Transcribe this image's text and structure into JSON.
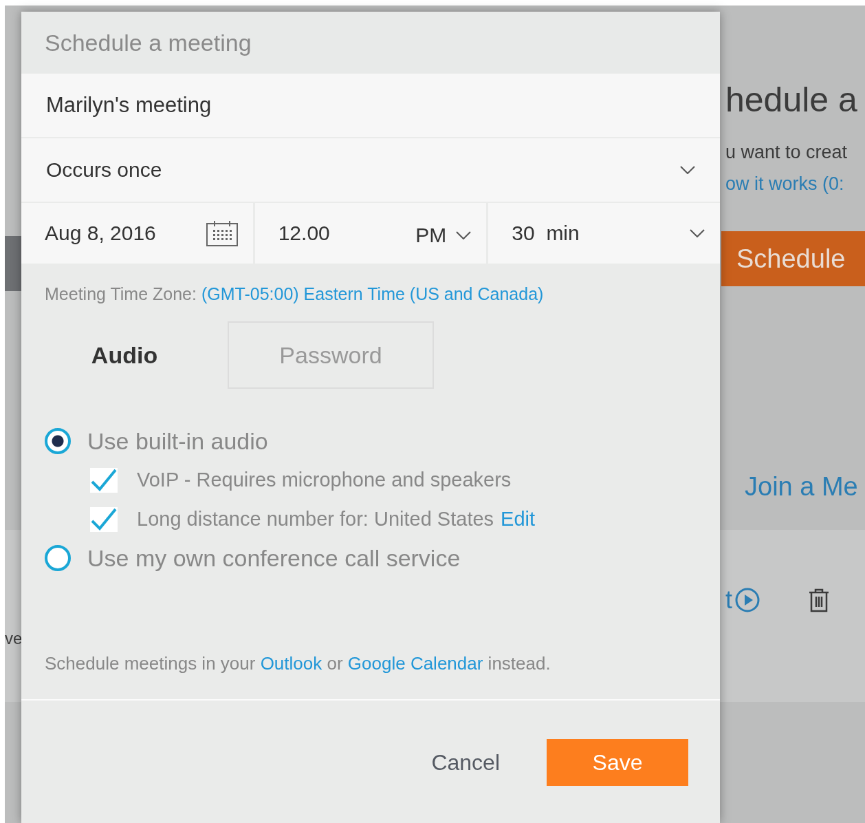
{
  "background": {
    "heading": "hedule a",
    "intro": "u want to creat",
    "video_link": "ow it works (0:",
    "schedule_button": "Schedule",
    "join_heading": "Join a Me",
    "start_link": "t",
    "left_fragments": [
      "ve"
    ]
  },
  "modal": {
    "title": "Schedule a meeting",
    "meeting_name": {
      "value": "Marilyn's meeting"
    },
    "recurrence": {
      "value": "Occurs once"
    },
    "date": {
      "value": "Aug 8, 2016"
    },
    "time": {
      "value": "12.00",
      "period": "PM"
    },
    "duration": {
      "value": "30",
      "unit": "min"
    },
    "time_zone": {
      "label": "Meeting Time Zone:",
      "link": "(GMT-05:00) Eastern Time (US and Canada)"
    },
    "tabs": [
      {
        "label": "Audio",
        "selected": true
      },
      {
        "label": "Password",
        "selected": false
      }
    ],
    "audio_options": [
      {
        "label": "Use built-in audio",
        "selected": true,
        "checks": [
          {
            "label": "VoIP - Requires microphone and speakers",
            "checked": true
          },
          {
            "label": "Long distance number for: United States",
            "checked": true,
            "link": "Edit"
          }
        ]
      },
      {
        "label": "Use my own conference call service",
        "selected": false
      }
    ],
    "calendar_note": {
      "before": "Schedule meetings in your",
      "link_1": "Outlook",
      "middle": "or",
      "link_2": "Google Calendar",
      "after": "instead."
    },
    "buttons": [
      {
        "label": "Cancel",
        "kind": "secondary"
      },
      {
        "label": "Save",
        "kind": "primary"
      }
    ]
  }
}
